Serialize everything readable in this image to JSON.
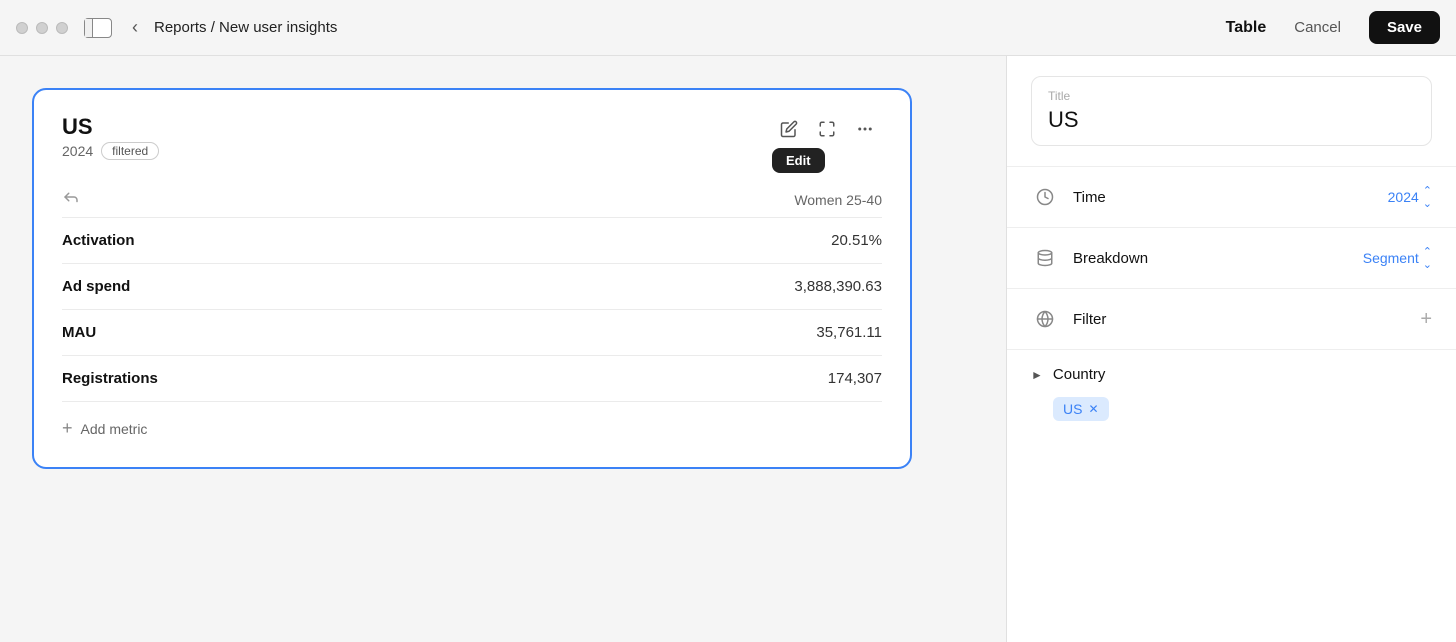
{
  "titlebar": {
    "breadcrumb": "Reports / New user insights",
    "panel_title": "Table",
    "cancel_label": "Cancel",
    "save_label": "Save"
  },
  "card": {
    "title": "US",
    "year": "2024",
    "filter_badge": "filtered",
    "segment_label": "Women 25-40",
    "metrics": [
      {
        "name": "Activation",
        "value": "20.51%"
      },
      {
        "name": "Ad spend",
        "value": "3,888,390.63"
      },
      {
        "name": "MAU",
        "value": "35,761.11"
      },
      {
        "name": "Registrations",
        "value": "174,307"
      }
    ],
    "add_metric_label": "Add metric",
    "edit_tooltip": "Edit"
  },
  "right_panel": {
    "title_field": {
      "label": "Title",
      "value": "US"
    },
    "time_label": "Time",
    "time_value": "2024",
    "breakdown_label": "Breakdown",
    "breakdown_value": "Segment",
    "filter_label": "Filter",
    "country_label": "Country",
    "country_tags": [
      {
        "label": "US"
      }
    ]
  }
}
